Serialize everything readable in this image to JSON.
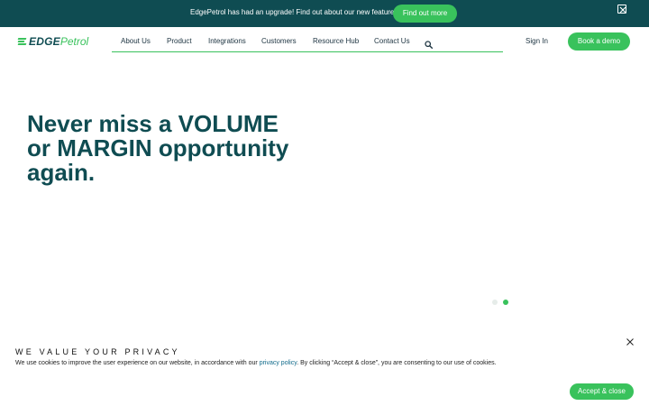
{
  "announcement": {
    "text": "EdgePetrol has had an upgrade! Find out about our new features here.",
    "button_label": "Find out more"
  },
  "logo": {
    "part1": "EDGE",
    "part2": "Petrol"
  },
  "nav": {
    "items": [
      {
        "label": "About Us"
      },
      {
        "label": "Product"
      },
      {
        "label": "Integrations"
      },
      {
        "label": "Customers"
      },
      {
        "label": "Resource Hub"
      },
      {
        "label": "Contact Us"
      }
    ],
    "signin_label": "Sign In",
    "demo_label": "Book a demo"
  },
  "hero": {
    "line1": "Never miss a VOLUME",
    "line2": "or MARGIN opportunity",
    "line3": "again."
  },
  "carousel": {
    "slide_count": 2,
    "active_slide": 2
  },
  "cookie": {
    "title": "WE VALUE YOUR PRIVACY",
    "text_before": "We use cookies to improve the user experience on our website, in accordance with our ",
    "link_text": "privacy policy",
    "text_after": ". By clicking “Accept & close”, you are consenting to our use of cookies.",
    "accept_label": "Accept & close"
  },
  "colors": {
    "brand_dark": "#0f4c52",
    "accent_green": "#39c25c"
  }
}
